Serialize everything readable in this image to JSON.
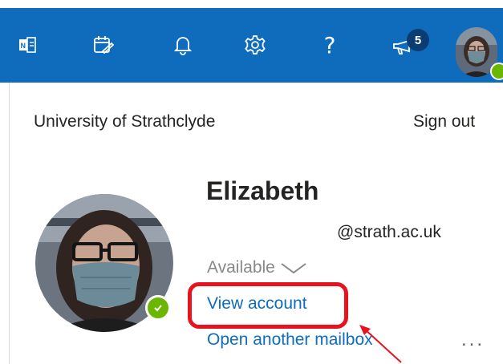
{
  "toolbar": {
    "icons": [
      {
        "name": "onenote-feed-icon"
      },
      {
        "name": "my-day-icon"
      },
      {
        "name": "notifications-bell-icon"
      },
      {
        "name": "settings-gear-icon"
      },
      {
        "name": "help-question-icon"
      },
      {
        "name": "whats-new-megaphone-icon"
      }
    ],
    "whats_new_count": "5",
    "accent_color": "#0f6cbd"
  },
  "account_panel": {
    "organization": "University of Strathclyde",
    "sign_out_label": "Sign out",
    "user_name": "Elizabeth",
    "email": "@strath.ac.uk",
    "status": "Available",
    "view_account_label": "View account",
    "open_mailbox_label": "Open another mailbox",
    "more_label": "..."
  },
  "annotation": {
    "highlight_color": "#e8131f"
  }
}
